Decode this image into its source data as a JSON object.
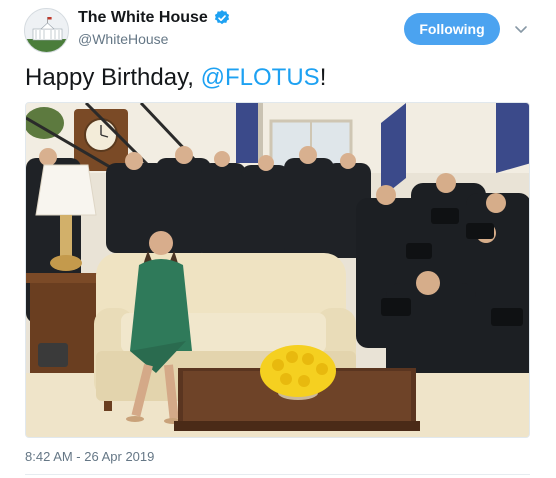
{
  "account": {
    "display_name": "The White House",
    "handle": "@WhiteHouse",
    "verified": true
  },
  "follow_button": {
    "label": "Following"
  },
  "tweet": {
    "text_before": "Happy Birthday, ",
    "mention": "@FLOTUS",
    "text_after": "!"
  },
  "timestamp": "8:42 AM - 26 Apr 2019",
  "colors": {
    "accent": "#1da1f2",
    "following_button": "#4ba3f0",
    "secondary_text": "#657786",
    "coat": "#2f7a5a",
    "roses": "#f5d020"
  },
  "icons": {
    "verified": "verified-badge-icon",
    "caret": "chevron-down-icon"
  }
}
